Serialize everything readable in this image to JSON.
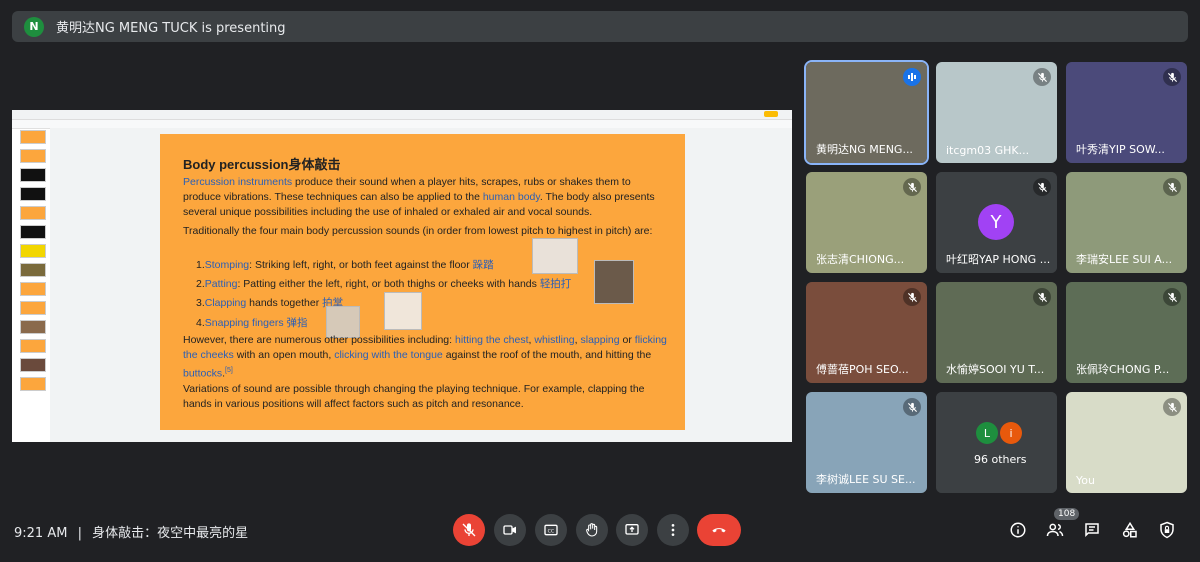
{
  "presenting_bar": {
    "avatar_letter": "N",
    "text": "黄明达NG MENG TUCK is presenting"
  },
  "slide": {
    "title": "Body percussion身体敲击",
    "p1_link": "Percussion instruments",
    "p1_a": " produce their sound when a player hits, scrapes, rubs or shakes them to produce vibrations. These techniques can also be applied to the ",
    "p1_link2": "human body",
    "p1_b": ". The body also presents several unique possibilities including the use of inhaled or exhaled air and vocal sounds.",
    "p2": "Traditionally the four main body percussion sounds (in order from lowest pitch to highest in pitch) are:",
    "items": [
      {
        "n": "1.",
        "link": "Stomping",
        "rest": ": Striking left, right, or both feet against the floor ",
        "cn": "跺踏"
      },
      {
        "n": "2.",
        "link": "Patting",
        "rest": ": Patting either the left, right, or both thighs or cheeks with hands ",
        "cn": "轻拍打"
      },
      {
        "n": "3.",
        "link": "Clapping",
        "rest": " hands together ",
        "cn": "拍掌"
      },
      {
        "n": "4.",
        "link": "Snapping fingers",
        "rest": " ",
        "cn": "弹指"
      }
    ],
    "p3_a": "However, there are numerous other possibilities including: ",
    "p3_l1": "hitting the chest",
    "p3_s1": ", ",
    "p3_l2": "whistling",
    "p3_s2": ", ",
    "p3_l3": "slapping",
    "p3_s3": " or ",
    "p3_l4": "flicking the cheeks",
    "p3_b": " with an open mouth, ",
    "p3_l5": "clicking with the tongue",
    "p3_c": " against the roof of the mouth, and hitting the ",
    "p3_l6": "buttocks",
    "p3_d": ".",
    "p3_sup": "[5]",
    "p4": "Variations of sound are possible through changing the playing technique. For example, clapping the hands in various positions will affect factors such as pitch and resonance."
  },
  "participants": [
    {
      "name": "黄明达NG MENG...",
      "bg": "#6d6a5e",
      "speaking": true
    },
    {
      "name": "itcgm03 GHK...",
      "bg": "#b8c7c9"
    },
    {
      "name": "叶秀清YIP SOW...",
      "bg": "#4b4a7a"
    },
    {
      "name": "张志清CHIONG...",
      "bg": "#9aa07a"
    },
    {
      "name": "叶红昭YAP HONG ...",
      "bg": "#3c4043",
      "avatar": "Y",
      "avatar_color": "#a142f4"
    },
    {
      "name": "李瑞安LEE SUI A...",
      "bg": "#8e9a7a"
    },
    {
      "name": "傅蔷蓓POH SEO...",
      "bg": "#7a4d3c"
    },
    {
      "name": "水愉婷SOOI YU T...",
      "bg": "#5f6b55"
    },
    {
      "name": "张佩玲CHONG P...",
      "bg": "#5d6d56"
    },
    {
      "name": "李树诚LEE SU SE...",
      "bg": "#88a4b8"
    },
    {
      "name": "96 others",
      "bg": "#3c4043",
      "others": true,
      "a1": "L",
      "a1c": "#1e8e3e",
      "a2": "i",
      "a2c": "#e8590c"
    },
    {
      "name": "You",
      "bg": "#d8dcc8"
    }
  ],
  "bottom": {
    "time": "9:21 AM",
    "sep": "|",
    "meeting": "身体敲击：夜空中最亮的星",
    "participants_count": "108",
    "colors": {
      "end_call": "#ea4335",
      "mic_off": "#ea4335"
    }
  }
}
